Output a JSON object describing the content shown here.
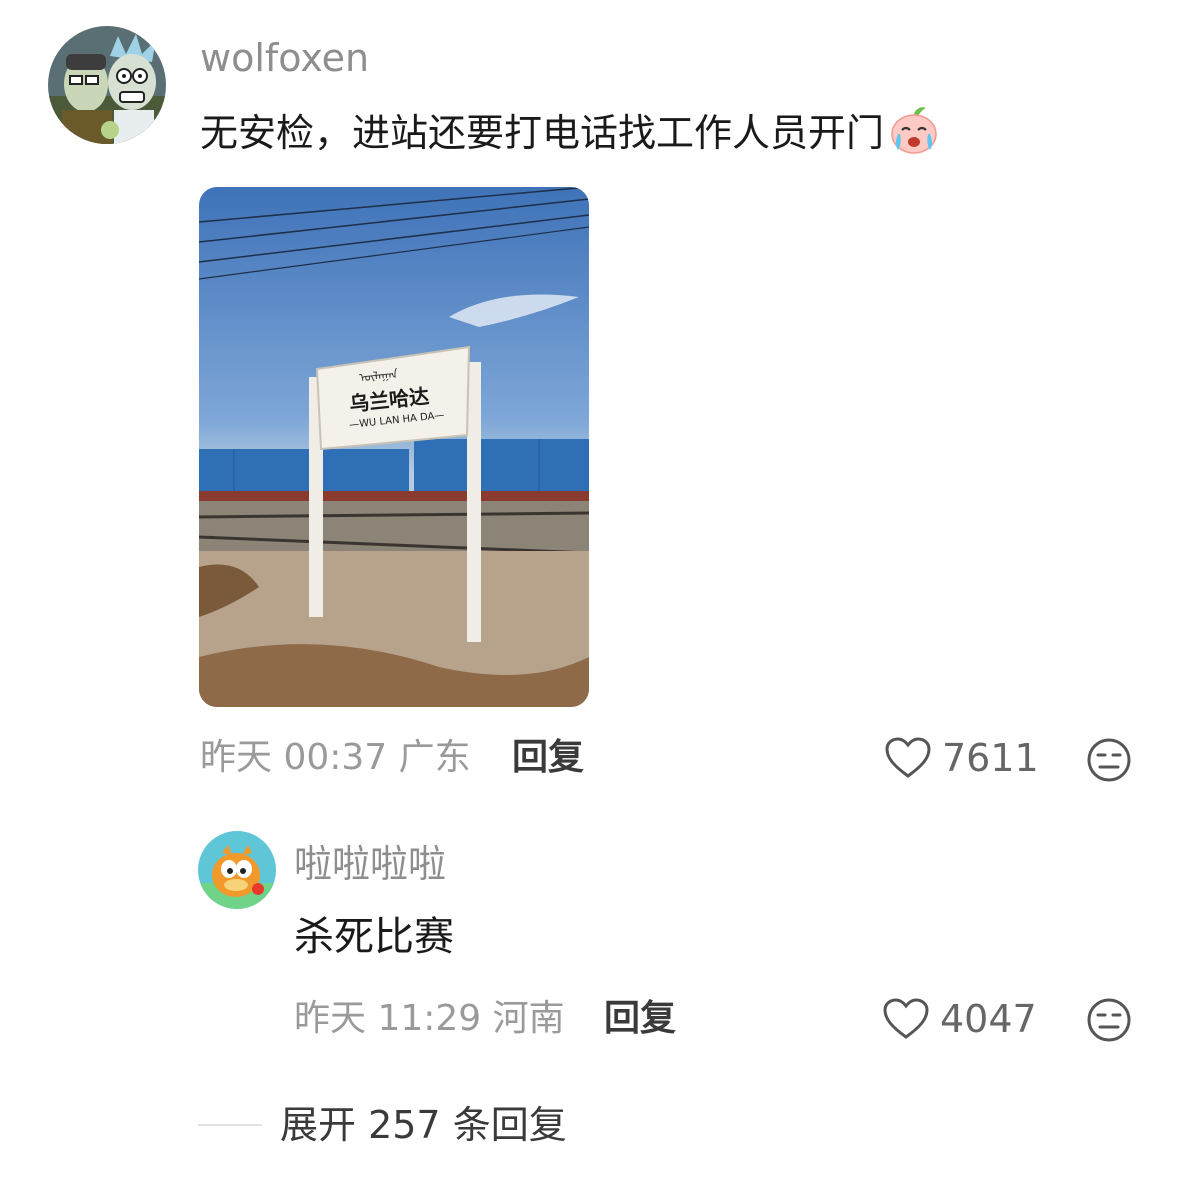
{
  "comment": {
    "username": "wolfoxen",
    "text": "无安检，进站还要打电话找工作人员开门",
    "emoji_icon": "crying-peach-emoji",
    "image": {
      "sign_top_script": "ᠦᠯᠠᠭᠠᠨ",
      "sign_main": "乌兰哈达",
      "sign_sub": "—WU LAN HA DA—"
    },
    "date": "昨天 00:37 广东",
    "reply_label": "回复",
    "likes": "7611",
    "like_icon": "heart-outline-icon",
    "dislike_icon": "meh-face-icon"
  },
  "sub_comment": {
    "username": "啦啦啦啦",
    "text": "杀死比赛",
    "date": "昨天 11:29 河南",
    "reply_label": "回复",
    "likes": "4047",
    "like_icon": "heart-outline-icon",
    "dislike_icon": "meh-face-icon"
  },
  "expand_replies": "展开 257 条回复",
  "colors": {
    "username": "#8e8e8e",
    "meta": "#9a9a9a",
    "reply": "#3a3a3a",
    "text": "#1a1a1a"
  }
}
